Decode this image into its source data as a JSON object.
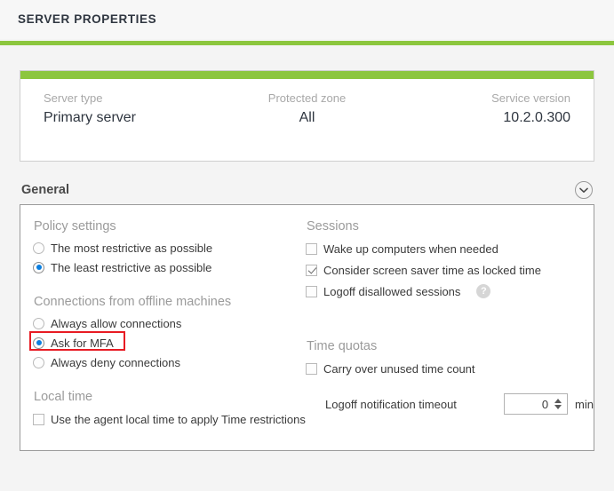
{
  "header": {
    "title": "SERVER PROPERTIES",
    "accent_color": "#8cc63e"
  },
  "summary": {
    "fields": [
      {
        "label": "Server type",
        "value": "Primary server"
      },
      {
        "label": "Protected zone",
        "value": "All"
      },
      {
        "label": "Service version",
        "value": "10.2.0.300"
      }
    ]
  },
  "general_section": {
    "title": "General",
    "collapse_icon": "chevron-down-icon",
    "left": {
      "policy_settings": {
        "title": "Policy settings",
        "options": [
          {
            "label": "The most restrictive as possible",
            "checked": false
          },
          {
            "label": "The least restrictive as possible",
            "checked": true
          }
        ]
      },
      "offline_connections": {
        "title": "Connections from offline machines",
        "options": [
          {
            "label": "Always allow connections",
            "checked": false
          },
          {
            "label": "Ask for MFA",
            "checked": true,
            "highlight": true
          },
          {
            "label": "Always deny connections",
            "checked": false
          }
        ]
      },
      "local_time": {
        "title": "Local time",
        "options": [
          {
            "label": "Use the agent local time to apply Time restrictions",
            "checked": false
          }
        ]
      }
    },
    "right": {
      "sessions": {
        "title": "Sessions",
        "options": [
          {
            "label": "Wake up computers when needed",
            "checked": false
          },
          {
            "label": "Consider screen saver time as locked time",
            "checked": true
          },
          {
            "label": "Logoff disallowed sessions",
            "checked": false,
            "help": "?"
          }
        ]
      },
      "time_quotas": {
        "title": "Time quotas",
        "options": [
          {
            "label": "Carry over unused time count",
            "checked": false
          }
        ],
        "timeout": {
          "label": "Logoff notification timeout",
          "value": "0",
          "unit": "min"
        }
      }
    }
  },
  "colors": {
    "accent_green": "#8cc63e",
    "radio_blue": "#0a7ee0",
    "annotation_red": "#e81b23"
  }
}
